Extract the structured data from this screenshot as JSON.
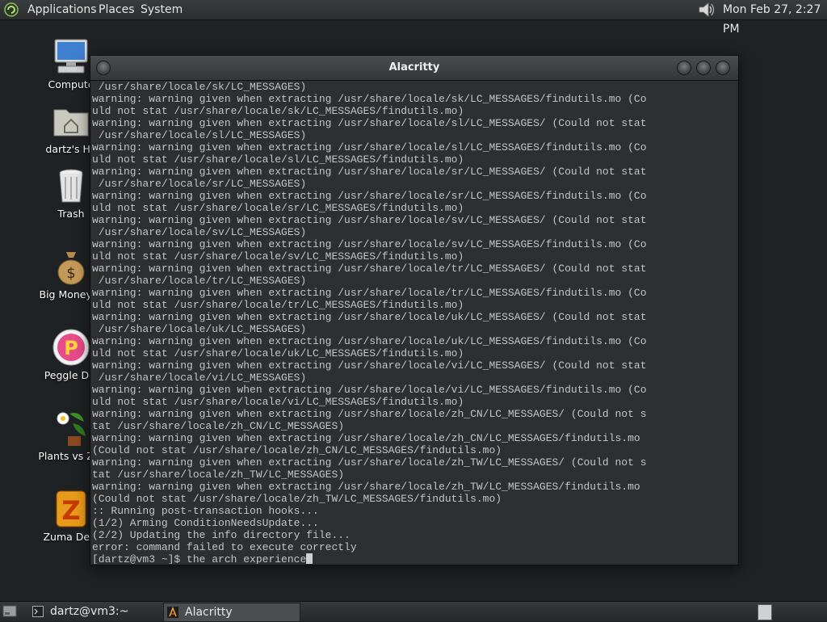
{
  "top_panel": {
    "menus": [
      "Applications",
      "Places",
      "System"
    ],
    "clock": "Mon Feb 27,  2:27 PM",
    "volume_icon": "speaker-icon"
  },
  "desktop": {
    "icons": [
      {
        "label": "Compute",
        "icon": "computer-icon"
      },
      {
        "label": "dartz's Ho",
        "icon": "home-folder-icon"
      },
      {
        "label": "Trash",
        "icon": "trash-icon"
      },
      {
        "label": "Big Money D",
        "icon": "money-bag-icon"
      },
      {
        "label": "Peggle Del",
        "icon": "peggle-icon"
      },
      {
        "label": "Plants vs Zor",
        "icon": "plants-icon"
      },
      {
        "label": "Zuma Delu",
        "icon": "zuma-icon"
      }
    ]
  },
  "window": {
    "title": "Alacritty",
    "terminal_lines": [
      " /usr/share/locale/sk/LC_MESSAGES)",
      "warning: warning given when extracting /usr/share/locale/sk/LC_MESSAGES/findutils.mo (Co",
      "uld not stat /usr/share/locale/sk/LC_MESSAGES/findutils.mo)",
      "warning: warning given when extracting /usr/share/locale/sl/LC_MESSAGES/ (Could not stat",
      " /usr/share/locale/sl/LC_MESSAGES)",
      "warning: warning given when extracting /usr/share/locale/sl/LC_MESSAGES/findutils.mo (Co",
      "uld not stat /usr/share/locale/sl/LC_MESSAGES/findutils.mo)",
      "warning: warning given when extracting /usr/share/locale/sr/LC_MESSAGES/ (Could not stat",
      " /usr/share/locale/sr/LC_MESSAGES)",
      "warning: warning given when extracting /usr/share/locale/sr/LC_MESSAGES/findutils.mo (Co",
      "uld not stat /usr/share/locale/sr/LC_MESSAGES/findutils.mo)",
      "warning: warning given when extracting /usr/share/locale/sv/LC_MESSAGES/ (Could not stat",
      " /usr/share/locale/sv/LC_MESSAGES)",
      "warning: warning given when extracting /usr/share/locale/sv/LC_MESSAGES/findutils.mo (Co",
      "uld not stat /usr/share/locale/sv/LC_MESSAGES/findutils.mo)",
      "warning: warning given when extracting /usr/share/locale/tr/LC_MESSAGES/ (Could not stat",
      " /usr/share/locale/tr/LC_MESSAGES)",
      "warning: warning given when extracting /usr/share/locale/tr/LC_MESSAGES/findutils.mo (Co",
      "uld not stat /usr/share/locale/tr/LC_MESSAGES/findutils.mo)",
      "warning: warning given when extracting /usr/share/locale/uk/LC_MESSAGES/ (Could not stat",
      " /usr/share/locale/uk/LC_MESSAGES)",
      "warning: warning given when extracting /usr/share/locale/uk/LC_MESSAGES/findutils.mo (Co",
      "uld not stat /usr/share/locale/uk/LC_MESSAGES/findutils.mo)",
      "warning: warning given when extracting /usr/share/locale/vi/LC_MESSAGES/ (Could not stat",
      " /usr/share/locale/vi/LC_MESSAGES)",
      "warning: warning given when extracting /usr/share/locale/vi/LC_MESSAGES/findutils.mo (Co",
      "uld not stat /usr/share/locale/vi/LC_MESSAGES/findutils.mo)",
      "warning: warning given when extracting /usr/share/locale/zh_CN/LC_MESSAGES/ (Could not s",
      "tat /usr/share/locale/zh_CN/LC_MESSAGES)",
      "warning: warning given when extracting /usr/share/locale/zh_CN/LC_MESSAGES/findutils.mo ",
      "(Could not stat /usr/share/locale/zh_CN/LC_MESSAGES/findutils.mo)",
      "warning: warning given when extracting /usr/share/locale/zh_TW/LC_MESSAGES/ (Could not s",
      "tat /usr/share/locale/zh_TW/LC_MESSAGES)",
      "warning: warning given when extracting /usr/share/locale/zh_TW/LC_MESSAGES/findutils.mo ",
      "(Could not stat /usr/share/locale/zh_TW/LC_MESSAGES/findutils.mo)",
      ":: Running post-transaction hooks...",
      "(1/2) Arming ConditionNeedsUpdate...",
      "(2/2) Updating the info directory file...",
      "error: command failed to execute correctly"
    ],
    "prompt": "[dartz@vm3 ~]$ ",
    "command_input": "the arch experience"
  },
  "taskbar": {
    "tasks": [
      {
        "label": "dartz@vm3:~",
        "icon": "terminal-icon"
      },
      {
        "label": "Alacritty",
        "icon": "alacritty-icon"
      }
    ]
  },
  "colors": {
    "terminal_bg": "#2d2f31",
    "terminal_fg": "#c3c5c6",
    "panel_bg": "#2b2d2f"
  }
}
